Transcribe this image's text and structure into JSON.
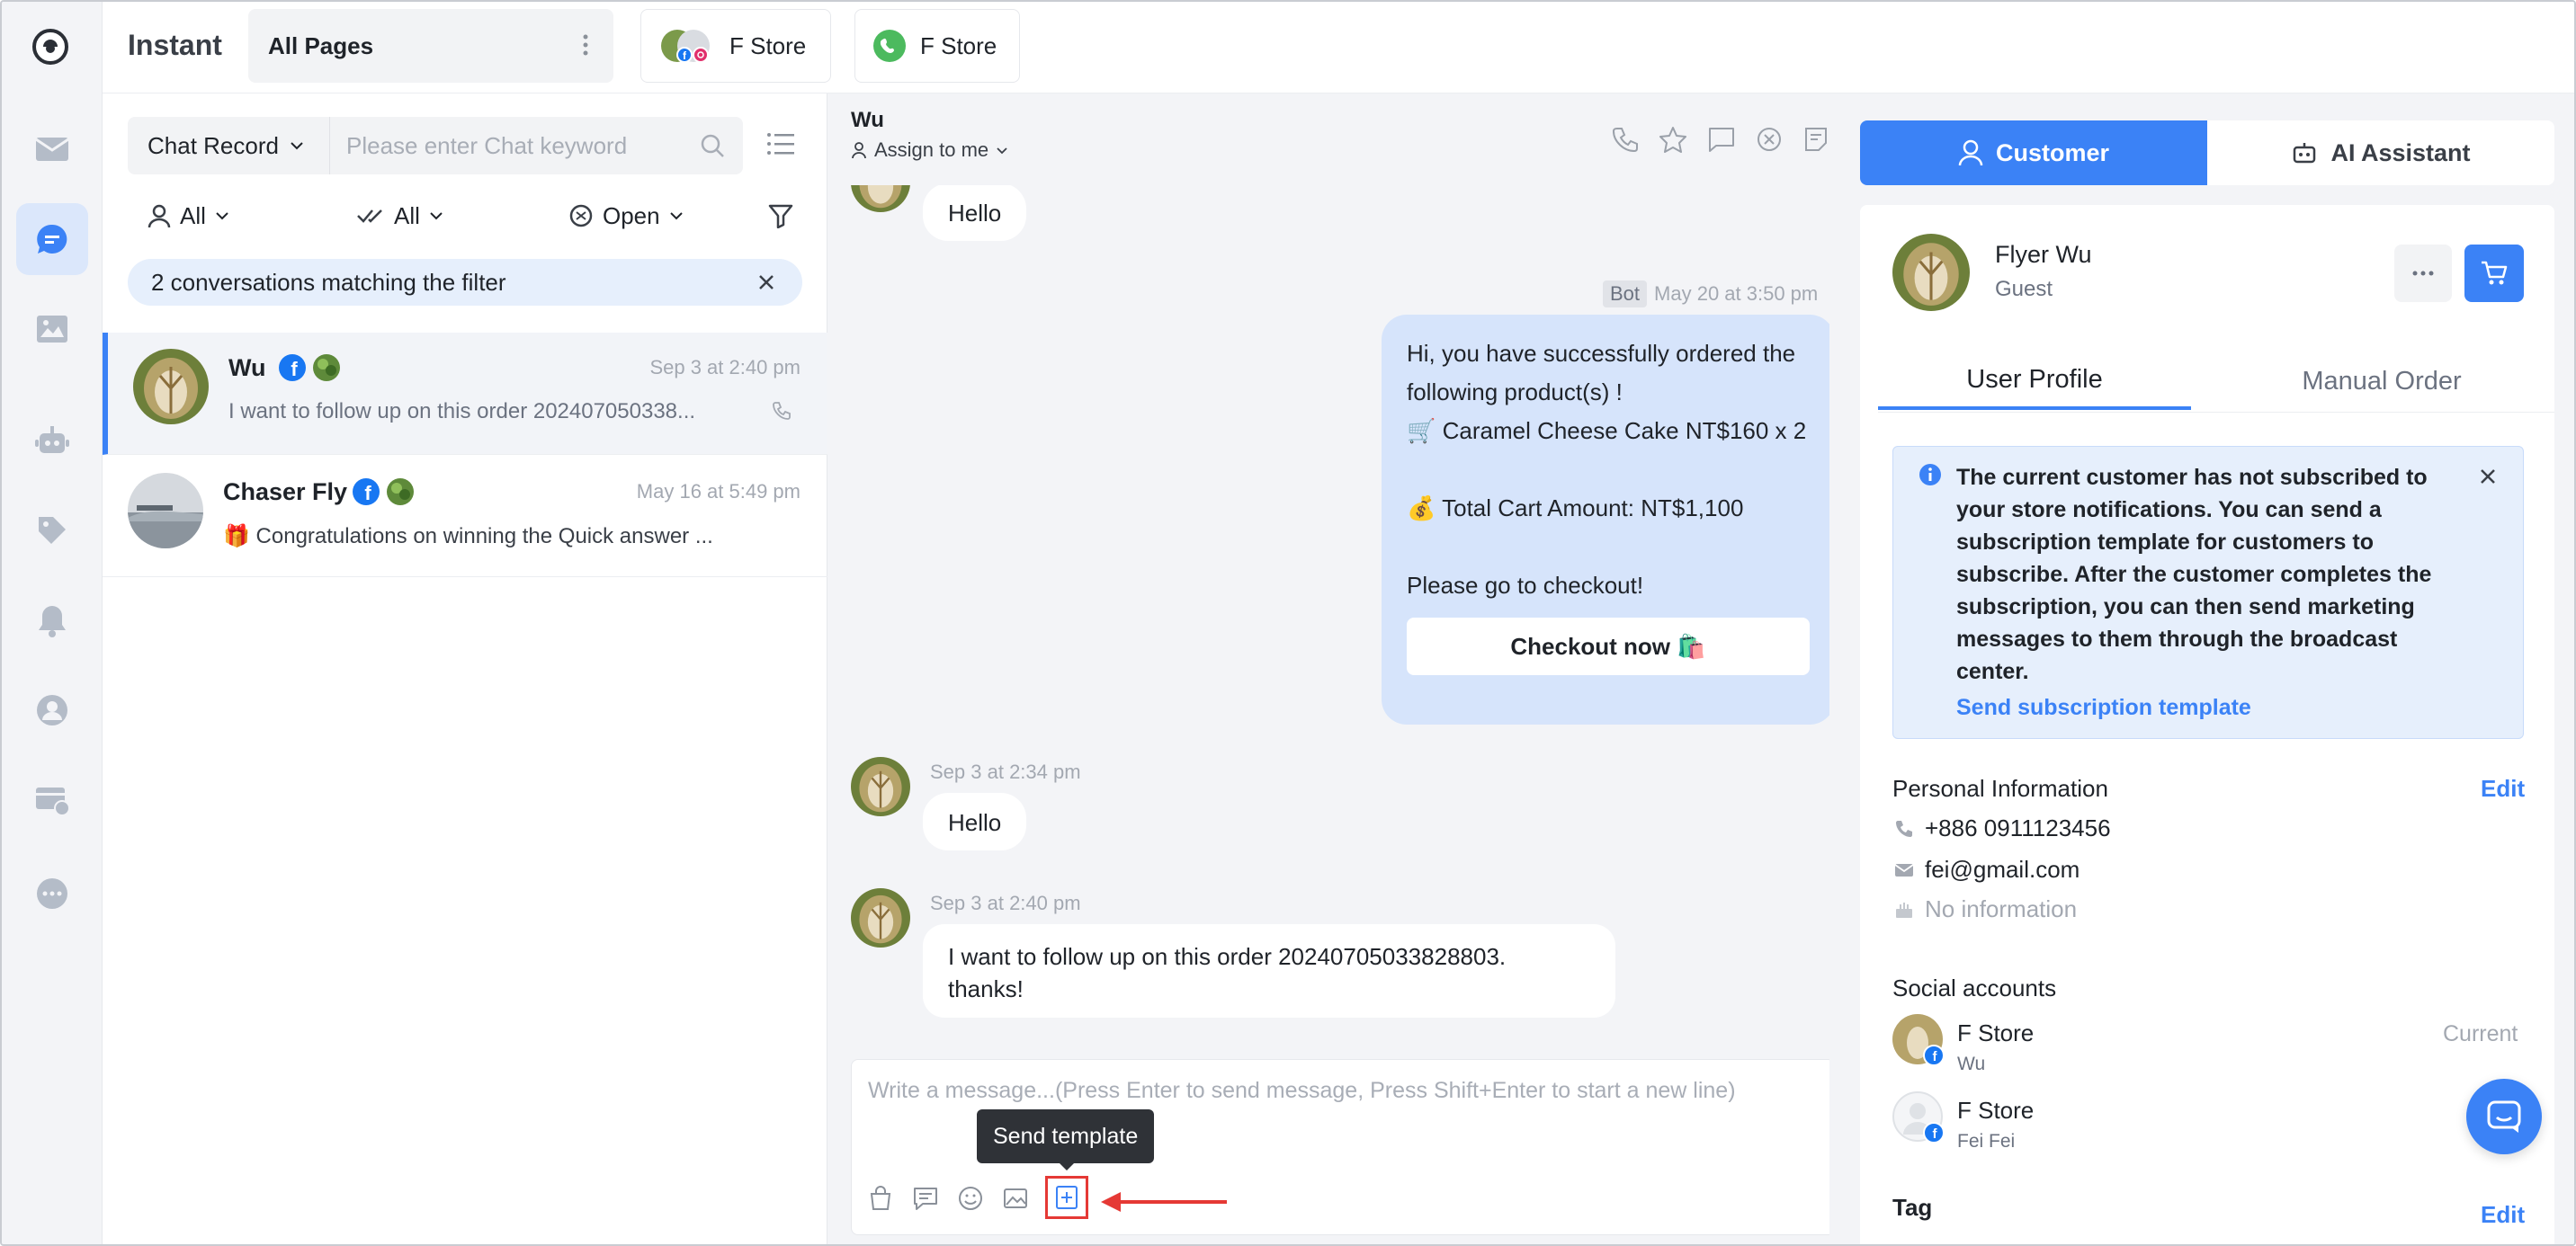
{
  "app": {
    "title": "Instant",
    "page_selector": "All Pages"
  },
  "top_tabs": [
    {
      "label": "F Store",
      "channel": "facebook-instagram"
    },
    {
      "label": "F Store",
      "channel": "whatsapp"
    }
  ],
  "list": {
    "chat_record_label": "Chat Record",
    "search_placeholder": "Please enter Chat keyword",
    "filters": {
      "assignee": "All",
      "read": "All",
      "status": "Open"
    },
    "match_banner": "2 conversations matching the filter",
    "conversations": [
      {
        "name": "Wu",
        "time": "Sep 3 at 2:40 pm",
        "preview": "I want to follow up on this order 202407050338..."
      },
      {
        "name": "Chaser Fly",
        "time": "May 16 at 5:49 pm",
        "preview": "🎁 Congratulations on winning the Quick answer   ..."
      }
    ]
  },
  "chat": {
    "contact_name": "Wu",
    "assign_label": "Assign to me",
    "msg_top": "Hello",
    "bot_label": "Bot",
    "bot_time": "May 20 at 3:50 pm",
    "bot_lines": [
      "Hi, you have successfully ordered the",
      "following product(s) !",
      "🛒 Caramel Cheese Cake NT$160 x 2",
      "",
      "💰 Total Cart Amount: NT$1,100",
      "",
      "Please go to checkout!"
    ],
    "checkout_button": "Checkout now 🛍️",
    "msg2_time": "Sep 3 at 2:34 pm",
    "msg2_text": "Hello",
    "msg3_time": "Sep 3 at 2:40 pm",
    "msg3_line1": "I want to follow up on this order 20240705033828803.",
    "msg3_line2": "thanks!",
    "composer_placeholder": "Write a message...(Press Enter to send message, Press Shift+Enter to start a new line)",
    "tooltip": "Send template"
  },
  "right": {
    "tab_customer": "Customer",
    "tab_ai": "AI Assistant",
    "customer_name": "Flyer Wu",
    "customer_type": "Guest",
    "subtab_profile": "User Profile",
    "subtab_order": "Manual Order",
    "notice_text": "The current customer has not subscribed to your store notifications. You can send a subscription template for customers to subscribe. After the customer completes the subscription, you can then send marketing messages to them through the broadcast center.",
    "notice_link": "Send subscription template",
    "personal_info_title": "Personal Information",
    "edit_label": "Edit",
    "phone": "+886 0911123456",
    "email": "fei@gmail.com",
    "birthday": "No information",
    "social_title": "Social accounts",
    "social": [
      {
        "store": "F Store",
        "user": "Wu",
        "status": "Current"
      },
      {
        "store": "F Store",
        "user": "Fei Fei",
        "status": ""
      }
    ],
    "tag_title": "Tag",
    "tag_edit": "Edit"
  },
  "colors": {
    "accent": "#3b82f6",
    "bot_bubble": "#d6e4fb",
    "annotation": "#e53935"
  }
}
